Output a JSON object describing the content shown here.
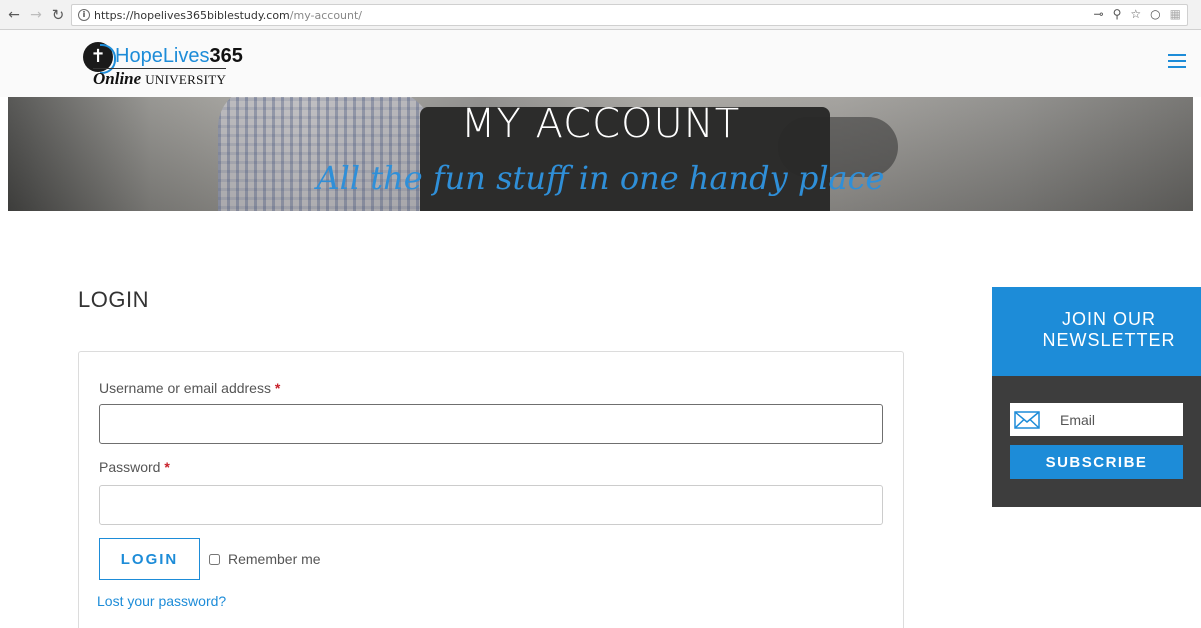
{
  "browser": {
    "url_host": "https://hopelives365biblestudy.com",
    "url_path": "/my-account/",
    "icons": [
      "key-icon",
      "zoom-icon",
      "star-icon",
      "extension-icon",
      "extension-icon"
    ]
  },
  "header": {
    "logo": {
      "name_part1": "HopeLives",
      "name_part2": "365",
      "sub_part1": "Online",
      "sub_part2": "UNIVERSITY"
    },
    "menu_icon": "hamburger-icon"
  },
  "hero": {
    "title": "MY ACCOUNT",
    "subtitle": "All the fun stuff in one handy place"
  },
  "login": {
    "title": "LOGIN",
    "username_label": "Username or email address",
    "password_label": "Password",
    "required_mark": "*",
    "login_button": "LOGIN",
    "remember_label": "Remember me",
    "lost_password": "Lost your password?"
  },
  "newsletter": {
    "heading_line1": "JOIN OUR",
    "heading_line2": "NEWSLETTER",
    "email_placeholder": "Email",
    "subscribe_button": "SUBSCRIBE"
  },
  "colors": {
    "accent": "#1d8cd8",
    "dark_panel": "#3d3d3d",
    "required": "#c8202a"
  }
}
